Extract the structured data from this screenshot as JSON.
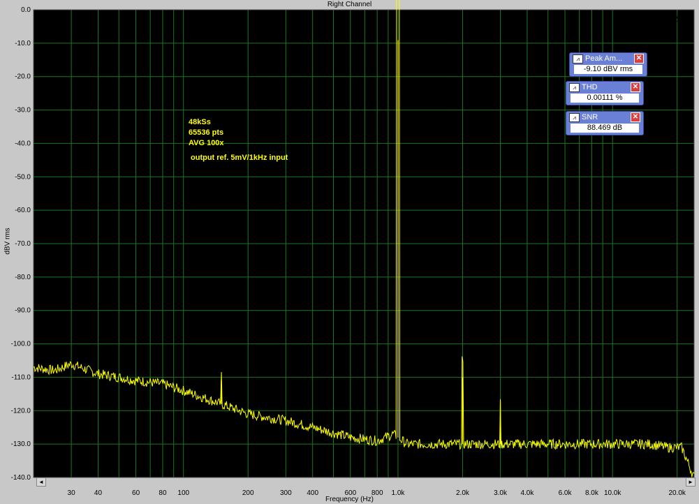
{
  "window": {
    "title": "Right Channel"
  },
  "chart_data": {
    "type": "line",
    "title": "Right Channel",
    "xlabel": "Frequency (Hz)",
    "ylabel": "dBV rms",
    "xscale": "log",
    "xlim": [
      20,
      24000
    ],
    "ylim": [
      -140,
      0
    ],
    "grid": true,
    "background": "#000000",
    "grid_color": "#1a7a1a",
    "trace_color": "#ffff00",
    "xticks": [
      30,
      40,
      60,
      80,
      100,
      200,
      300,
      400,
      600,
      800,
      1000,
      2000,
      3000,
      4000,
      6000,
      8000,
      10000,
      20000
    ],
    "xtick_labels": [
      "30",
      "40",
      "60",
      "80",
      "100",
      "200",
      "300",
      "400",
      "600",
      "800",
      "1.0k",
      "2.0k",
      "3.0k",
      "4.0k",
      "6.0k",
      "8.0k",
      "10.0k",
      "20.0k"
    ],
    "yticks": [
      0,
      -10,
      -20,
      -30,
      -40,
      -50,
      -60,
      -70,
      -80,
      -90,
      -100,
      -110,
      -120,
      -130,
      -140
    ],
    "ytick_labels": [
      "0.0",
      "-10.0",
      "-20.0",
      "-30.0",
      "-40.0",
      "-50.0",
      "-60.0",
      "-70.0",
      "-80.0",
      "-90.0",
      "-100.0",
      "-110.0",
      "-120.0",
      "-130.0",
      "-140.0"
    ],
    "annotations": [
      "48kSs",
      "65536 pts",
      "AVG 100x",
      "output ref. 5mV/1kHz input"
    ],
    "noise_floor": [
      [
        20,
        -107
      ],
      [
        25,
        -108
      ],
      [
        30,
        -106
      ],
      [
        40,
        -109
      ],
      [
        50,
        -110
      ],
      [
        60,
        -111
      ],
      [
        80,
        -112
      ],
      [
        100,
        -114
      ],
      [
        150,
        -118
      ],
      [
        200,
        -121
      ],
      [
        300,
        -123
      ],
      [
        400,
        -125
      ],
      [
        600,
        -128
      ],
      [
        800,
        -129
      ],
      [
        950,
        -127
      ],
      [
        1100,
        -130
      ],
      [
        2000,
        -130
      ],
      [
        3000,
        -130
      ],
      [
        5000,
        -130
      ],
      [
        10000,
        -130
      ],
      [
        15000,
        -130
      ],
      [
        18000,
        -131
      ],
      [
        21000,
        -131
      ],
      [
        24000,
        -140
      ]
    ],
    "peaks": [
      {
        "freq": 1000,
        "level": -9.1
      },
      {
        "freq": 150,
        "level": -111
      },
      {
        "freq": 2000,
        "level": -110
      },
      {
        "freq": 3000,
        "level": -117
      }
    ]
  },
  "meters": [
    {
      "name": "Peak Am...",
      "value": "-9.10 dBV rms"
    },
    {
      "name": "THD",
      "value": "0.00111 %"
    },
    {
      "name": "SNR",
      "value": "88.469 dB"
    }
  ],
  "scrollbar": {
    "left": "◄",
    "right": "►"
  },
  "icons": {
    "meter_icon": "waveform-icon",
    "close_icon": "close-icon",
    "logo_icon": "generator-icon"
  },
  "logo": {
    "glyph": "§∆"
  }
}
